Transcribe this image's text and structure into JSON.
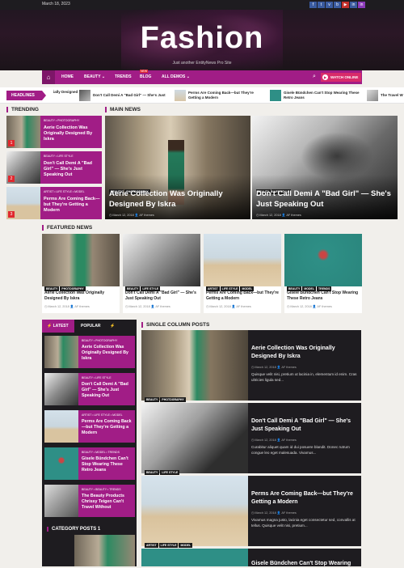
{
  "topbar": {
    "date": "March 18, 2023",
    "social": [
      "f",
      "t",
      "v",
      "b",
      "▶",
      "in",
      "in"
    ]
  },
  "header": {
    "logo": "Fashion",
    "tagline": "Just another EntityNews Pro Site"
  },
  "nav": {
    "items": [
      "HOME",
      "BEAUTY ⌄",
      "TRENDS",
      "BLOG",
      "ALL DEMOS ⌄"
    ],
    "new_badge": "NEW",
    "watch": "WATCH ONLINE"
  },
  "headlines": {
    "label": "HEADLINES",
    "items": [
      "ially Designed",
      "Don't Call Demi A \"Bad Girl\" — She's Just",
      "Perms Are Coming Back—but They're Getting a Modern",
      "Gisele Bündchen Can't Stop Wearing These Retro Jeans",
      "The Travel W"
    ]
  },
  "trending": {
    "title": "TRENDING",
    "items": [
      {
        "num": "1",
        "tags": "BEAUTY  •  PHOTOGRAPHY",
        "title": "Aerie Collection Was Originally Designed By Iskra"
      },
      {
        "num": "2",
        "tags": "BEAUTY  •  LIFE STYLE",
        "title": "Don't Call Demi A \"Bad Girl\" — She's Just Speaking Out"
      },
      {
        "num": "3",
        "tags": "ARTIST  •  LIFE STYLE  •  MODEL",
        "title": "Perms Are Coming Back—but They're Getting a Modern"
      }
    ]
  },
  "main_news": {
    "title": "MAIN NEWS",
    "items": [
      {
        "tags": [
          "BEAUTY",
          "PHOTOGRAPHY"
        ],
        "title": "Aerie Collection Was Originally Designed By Iskra",
        "meta": "◷ March 12, 2018   👤 AF themes"
      },
      {
        "tags": [
          "BEAUTY",
          "LIFE STYLE"
        ],
        "title": "Don't Call Demi A \"Bad Girl\" — She's Just Speaking Out",
        "meta": "◷ March 12, 2018   👤 AF themes"
      }
    ]
  },
  "featured": {
    "title": "FEATURED NEWS",
    "items": [
      {
        "tags": [
          "BEAUTY",
          "PHOTOGRAPHY"
        ],
        "title": "Aerie Collection Was Originally Designed By Iskra",
        "meta": "◷ March 12, 2018   👤 AF themes"
      },
      {
        "tags": [
          "BEAUTY",
          "LIFE STYLE"
        ],
        "title": "Don't Call Demi A \"Bad Girl\" — She's Just Speaking Out",
        "meta": "◷ March 12, 2018   👤 AF themes"
      },
      {
        "tags": [
          "ARTIST",
          "LIFE STYLE",
          "MODEL"
        ],
        "title": "Perms Are Coming Back—but They're Getting a Modern",
        "meta": "◷ March 12, 2018   👤 AF themes"
      },
      {
        "tags": [
          "BEAUTY",
          "MODEL",
          "TRENDS"
        ],
        "title": "Gisele Bündchen Can't Stop Wearing These Retro Jeans",
        "meta": "◷ March 12, 2018   👤 AF themes"
      }
    ]
  },
  "sidebar": {
    "tabs": [
      "⚡ LATEST",
      "POPULAR",
      "⚡ TRENDING"
    ],
    "items": [
      {
        "tags": "BEAUTY  •  PHOTOGRAPHY",
        "title": "Aerie Collection Was Originally Designed By Iskra"
      },
      {
        "tags": "BEAUTY  •  LIFE STYLE",
        "title": "Don't Call Demi A \"Bad Girl\" — She's Just Speaking Out"
      },
      {
        "tags": "ARTIST  •  LIFE STYLE  •  MODEL",
        "title": "Perms Are Coming Back—but They're Getting a Modern"
      },
      {
        "tags": "BEAUTY  •  MODEL  •  TRENDS",
        "title": "Gisele Bündchen Can't Stop Wearing These Retro Jeans"
      },
      {
        "tags": "BEAUTY  •  BEAUTY  •  TRENDS",
        "title": "The Beauty Products Chrissy Teigen Can't Travel Without"
      }
    ],
    "category_title": "CATEGORY POSTS 1"
  },
  "single_column": {
    "title": "SINGLE COLUMN POSTS",
    "items": [
      {
        "tags": [
          "BEAUTY",
          "PHOTOGRAPHY"
        ],
        "title": "Aerie Collection Was Originally Designed By Iskra",
        "meta": "◷ March 12, 2018   👤 AF themes",
        "excerpt": "Quisque velit nisi, pretium ut lacinia in, elementum id enim. Cras ultricies ligula sed..."
      },
      {
        "tags": [
          "BEAUTY",
          "LIFE STYLE"
        ],
        "title": "Don't Call Demi A \"Bad Girl\" — She's Just Speaking Out",
        "meta": "◷ March 12, 2018   👤 AF themes",
        "excerpt": "Curabitur aliquet quam id dui posuere blandit. Donec rutrum congue leo eget malesuada. Vivamus..."
      },
      {
        "tags": [
          "ARTIST",
          "LIFE STYLE",
          "MODEL"
        ],
        "title": "Perms Are Coming Back—but They're Getting a Modern",
        "meta": "◷ March 12, 2018   👤 AF themes",
        "excerpt": "Vivamus magna justo, lacinia eget consectetur sed, convallis at tellus. Quisque velit nisi, pretium..."
      },
      {
        "tags": [],
        "title": "Gisele Bündchen Can't Stop Wearing",
        "meta": "",
        "excerpt": ""
      }
    ]
  }
}
